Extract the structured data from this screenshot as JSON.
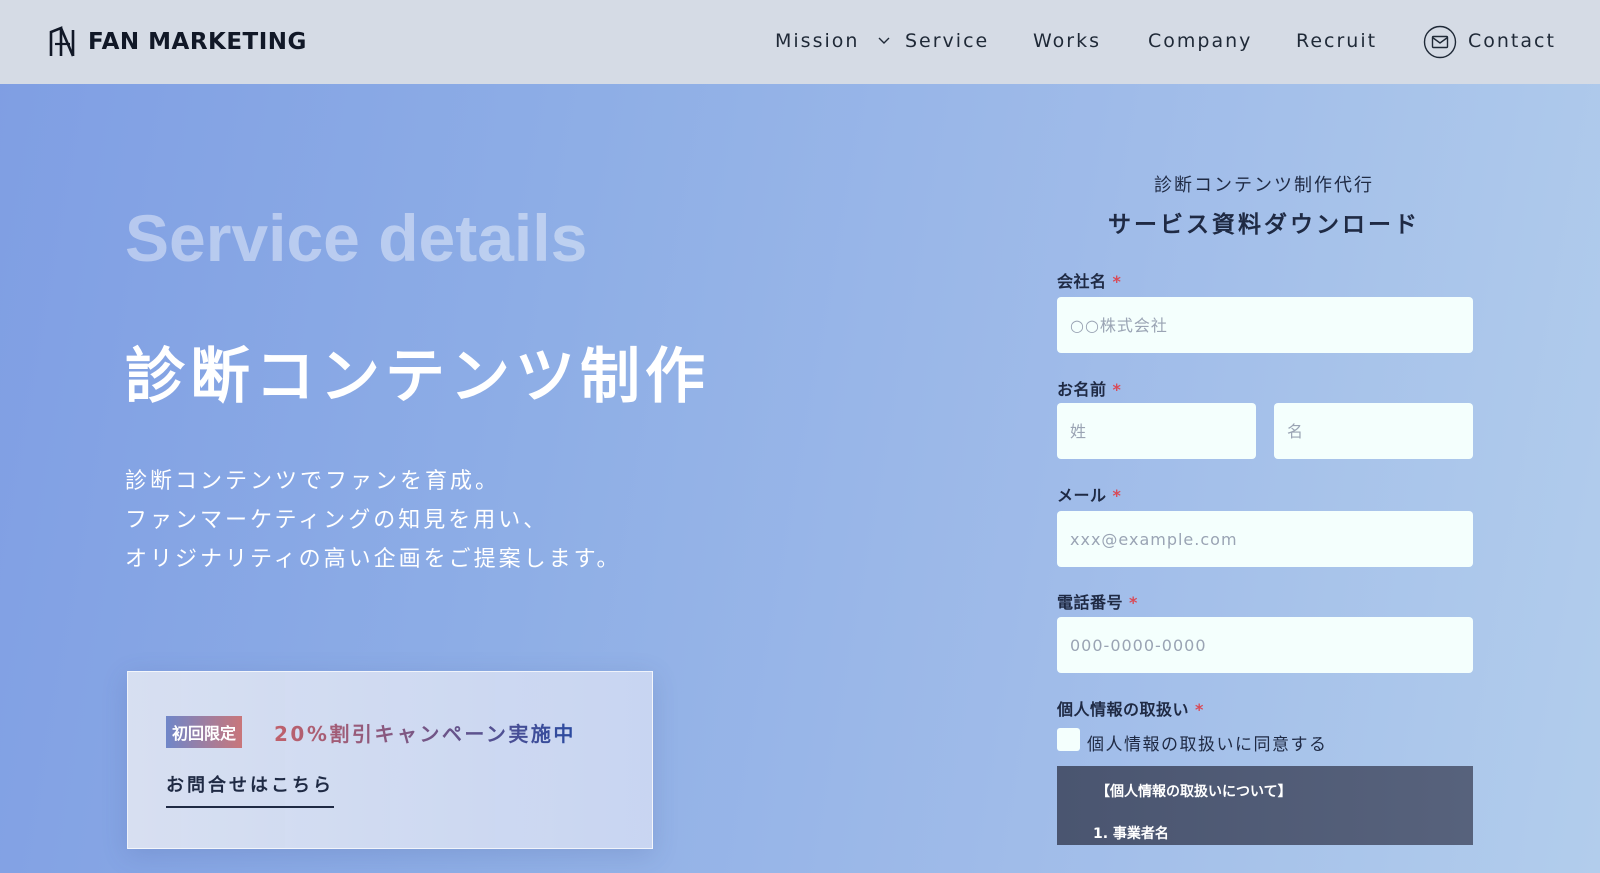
{
  "header": {
    "logo_text": "FAN MARKETING",
    "nav": [
      {
        "label": "Mission"
      },
      {
        "label": "Service"
      },
      {
        "label": "Works"
      },
      {
        "label": "Company"
      },
      {
        "label": "Recruit"
      },
      {
        "label": "Contact"
      }
    ],
    "service_has_dropdown": true
  },
  "hero": {
    "eyebrow": "Service details",
    "title": "診断コンテンツ制作",
    "description": [
      "診断コンテンツでファンを育成。",
      "ファンマーケティングの知見を用い、",
      "オリジナリティの高い企画をご提案します。"
    ]
  },
  "campaign": {
    "badge": "初回限定",
    "text": "20%割引キャンペーン実施中",
    "link": "お問合せはこちら"
  },
  "form": {
    "subtitle": "診断コンテンツ制作代行",
    "title": "サービス資料ダウンロード",
    "required_mark": "*",
    "company": {
      "label": "会社名",
      "placeholder": "○○株式会社",
      "value": ""
    },
    "name": {
      "label": "お名前",
      "last_placeholder": "姓",
      "first_placeholder": "名"
    },
    "email": {
      "label": "メール",
      "placeholder": "xxx@example.com",
      "value": ""
    },
    "phone": {
      "label": "電話番号",
      "placeholder": "000-0000-0000",
      "value": ""
    },
    "privacy": {
      "label": "個人情報の取扱い",
      "checkbox_label": "個人情報の取扱いに同意する",
      "checked": false,
      "box_heading": "【個人情報の取扱いについて】",
      "box_item": "1.  事業者名"
    }
  },
  "colors": {
    "header_bg": "#d5dbe5",
    "input_bg": "#f4fffd",
    "required": "#d94a57",
    "privacy_box_bg": "#4a5570"
  }
}
